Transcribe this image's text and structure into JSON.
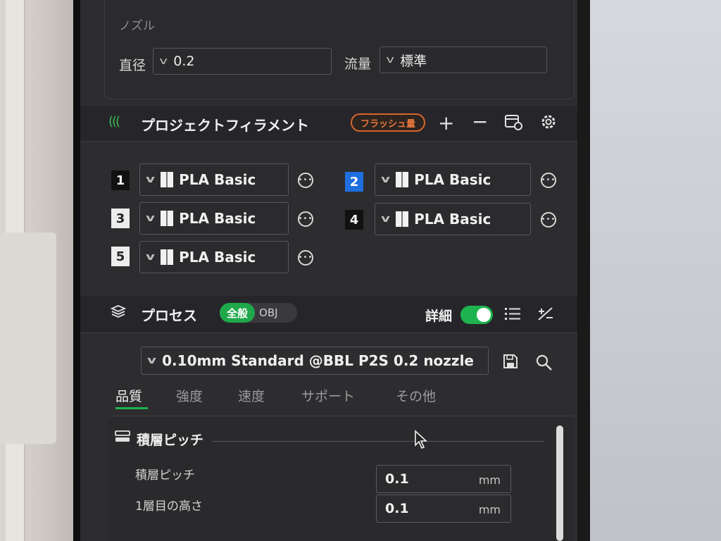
{
  "nozzle": {
    "title": "ノズル",
    "diameter_label": "直径",
    "diameter_value": "0.2",
    "flow_label": "流量",
    "flow_value": "標準"
  },
  "filament_section": {
    "title": "プロジェクトフィラメント",
    "flush_label": "フラッシュ量",
    "icons": [
      "filament-icon",
      "plus-icon",
      "minus-icon",
      "sync-icon",
      "gear-icon"
    ],
    "slots": [
      {
        "num": "1",
        "material": "PLA Basic"
      },
      {
        "num": "2",
        "material": "PLA Basic"
      },
      {
        "num": "3",
        "material": "PLA Basic"
      },
      {
        "num": "4",
        "material": "PLA Basic"
      },
      {
        "num": "5",
        "material": "PLA Basic"
      }
    ]
  },
  "process": {
    "title": "プロセス",
    "toggle_on": "全般",
    "toggle_off": "OBJ",
    "detail_label": "詳細",
    "detail_enabled": true,
    "preset": "0.10mm Standard @BBL P2S 0.2 nozzle",
    "tabs": [
      "品質",
      "強度",
      "速度",
      "サポート",
      "その他"
    ],
    "active_tab": "品質",
    "group_title": "積層ピッチ",
    "settings": [
      {
        "label": "積層ピッチ",
        "value": "0.1",
        "unit": "mm"
      },
      {
        "label": "1層目の高さ",
        "value": "0.1",
        "unit": "mm"
      }
    ]
  },
  "colors": {
    "accent_green": "#1fb34f",
    "flush_orange": "#e8773b",
    "slot_blue": "#1f6fe0"
  }
}
